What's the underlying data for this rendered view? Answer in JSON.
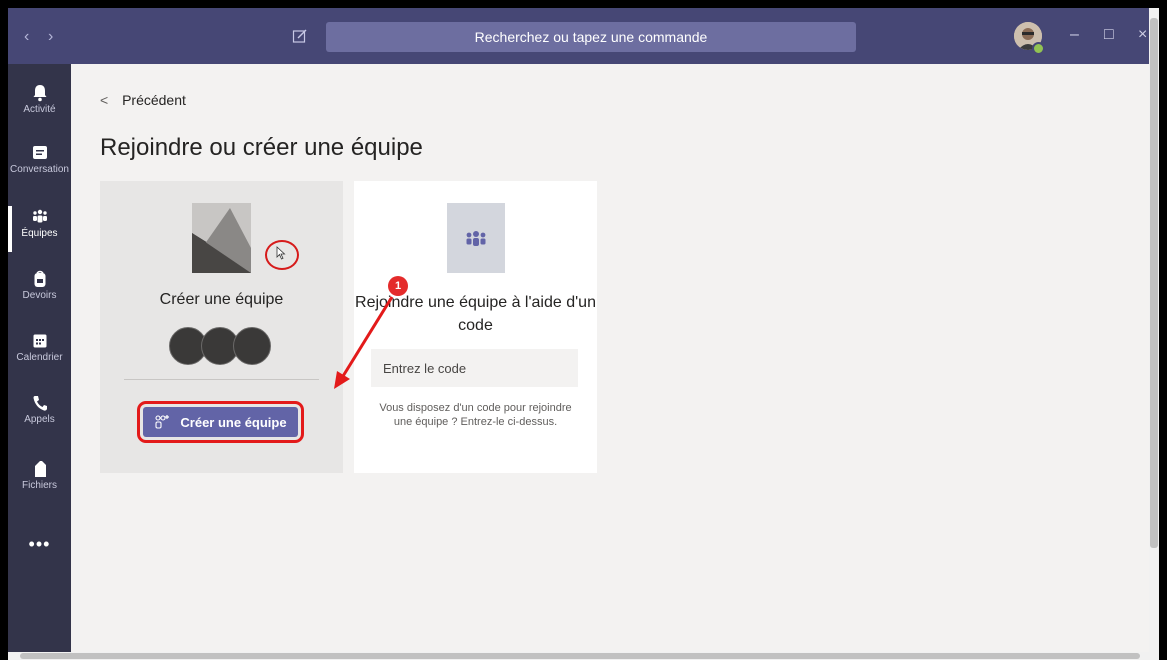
{
  "titlebar": {
    "search_placeholder": "Recherchez ou tapez une commande",
    "back_arrow": "‹",
    "forward_arrow": "›",
    "minimize": "–",
    "maximize": "□",
    "close": "×"
  },
  "rail": {
    "items": [
      {
        "label": "Activité",
        "icon": "bell-icon"
      },
      {
        "label": "Conversation",
        "icon": "chat-icon"
      },
      {
        "label": "Équipes",
        "icon": "teams-icon",
        "active": true
      },
      {
        "label": "Devoirs",
        "icon": "backpack-icon"
      },
      {
        "label": "Calendrier",
        "icon": "calendar-icon"
      },
      {
        "label": "Appels",
        "icon": "phone-icon"
      },
      {
        "label": "Fichiers",
        "icon": "file-icon"
      }
    ],
    "more": "•••"
  },
  "main": {
    "back_label": "Précédent",
    "title": "Rejoindre ou créer une équipe",
    "create_card": {
      "label": "Créer une équipe",
      "button_label": "Créer une équipe"
    },
    "join_card": {
      "title": "Rejoindre une équipe à l'aide d'un code",
      "code_placeholder": "Entrez le code",
      "help": "Vous disposez d'un code pour rejoindre une équipe ? Entrez-le ci-dessus."
    }
  },
  "annotations": {
    "step_badge": "1"
  },
  "colors": {
    "titlebar": "#464775",
    "rail": "#33344a",
    "accent": "#6264a7",
    "annotation": "#e31a1a"
  }
}
